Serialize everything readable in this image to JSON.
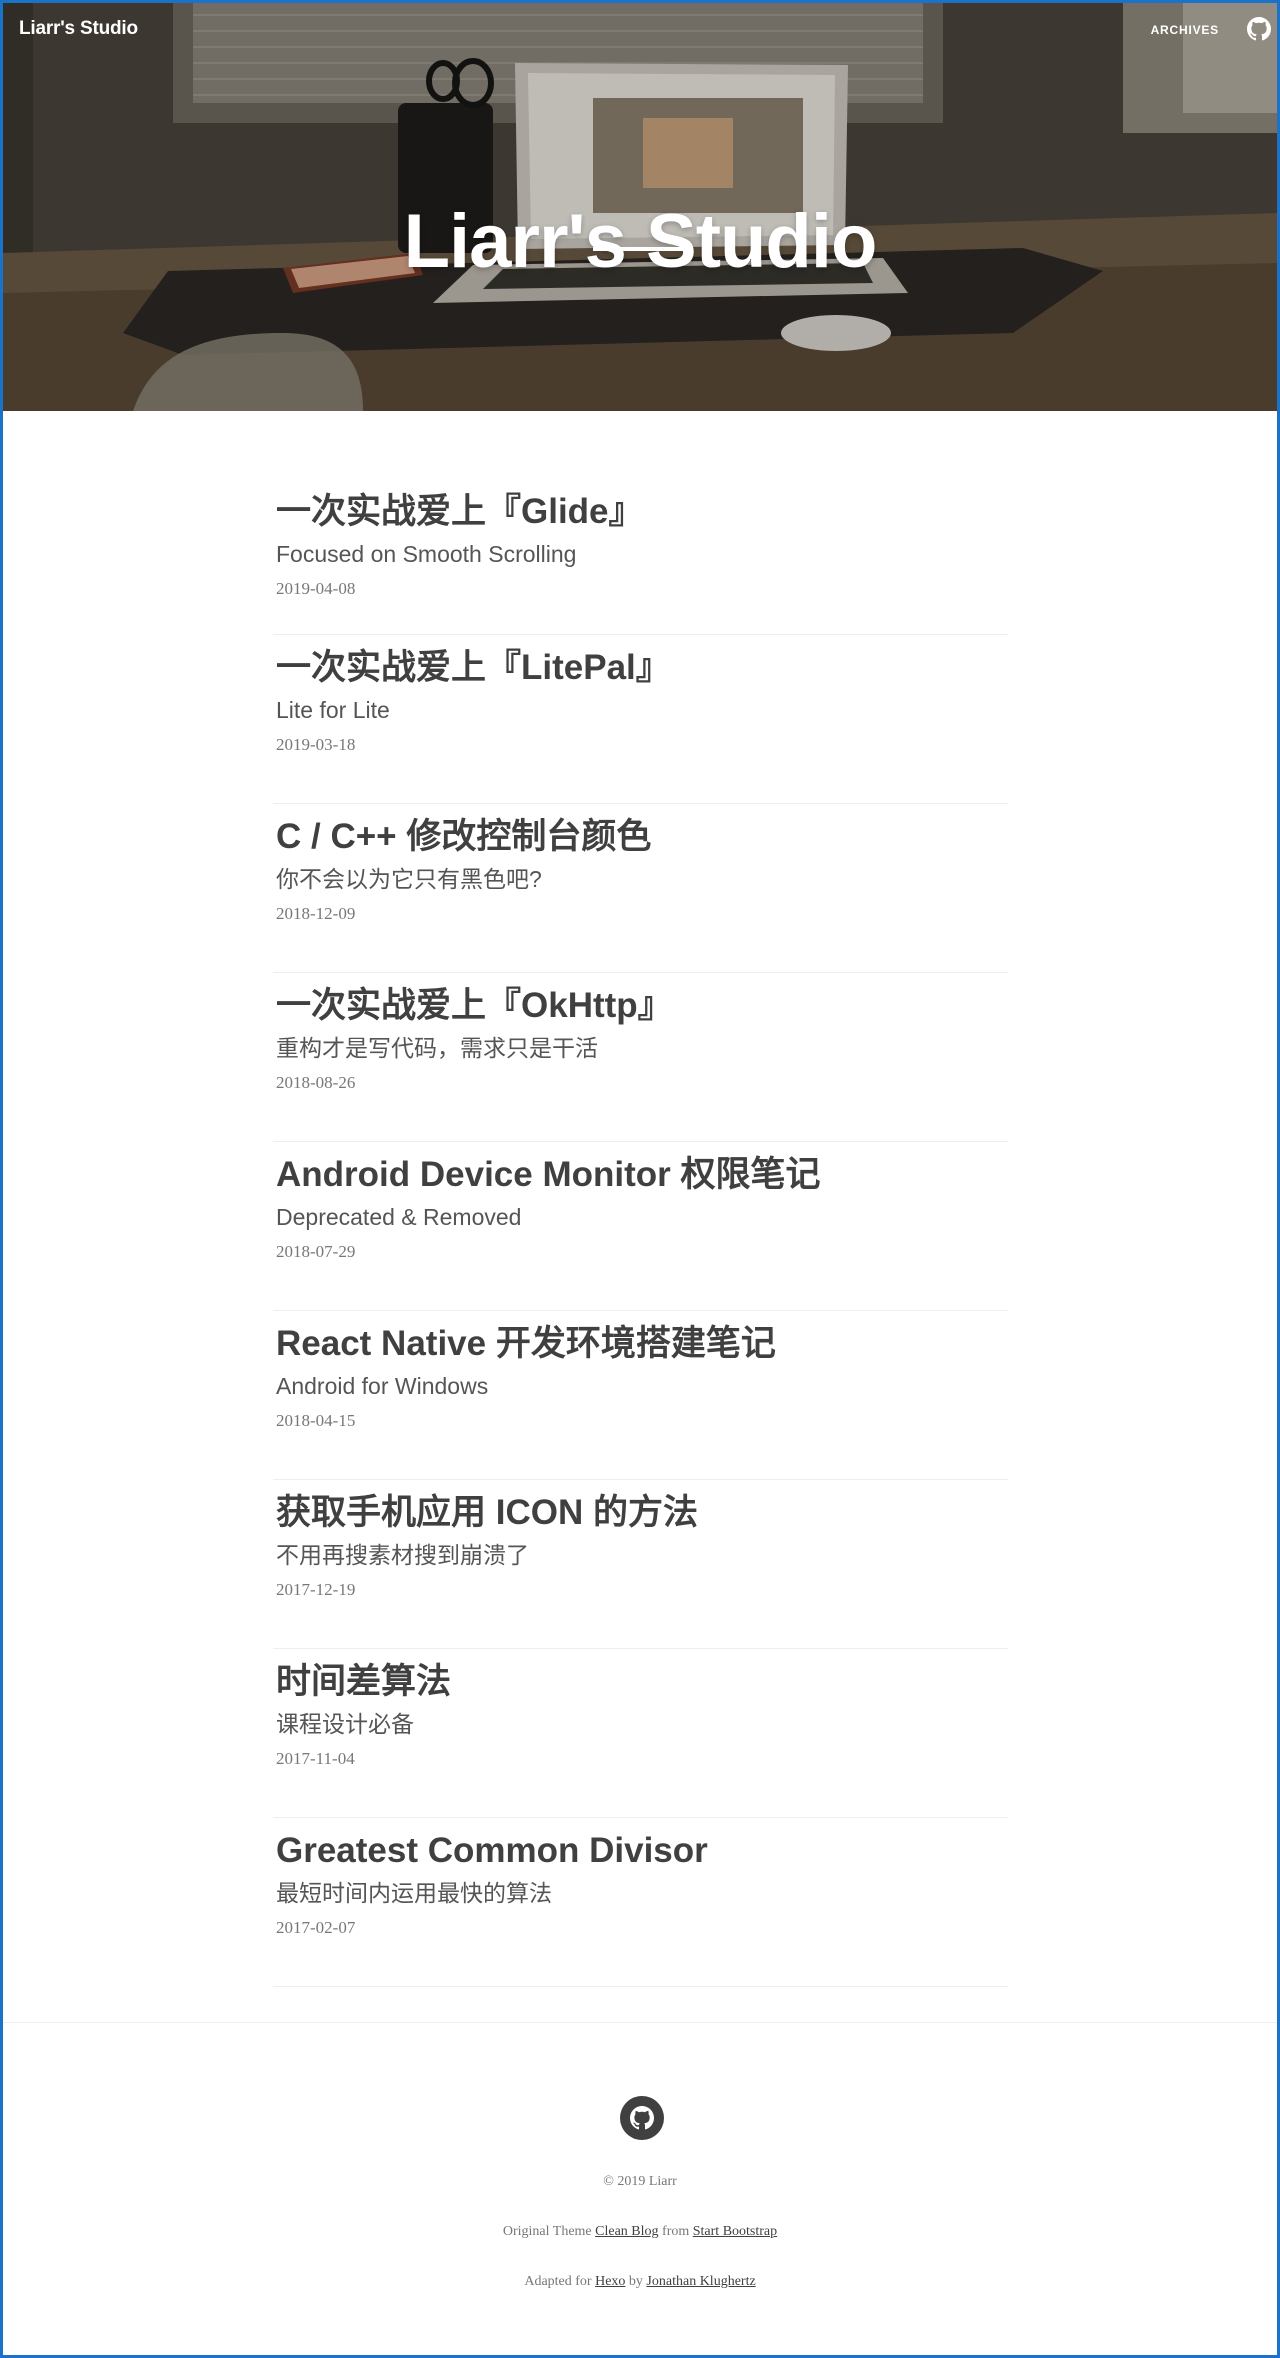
{
  "site": {
    "brand": "Liarr's Studio",
    "hero_title": "Liarr's Studio"
  },
  "nav": {
    "archives_label": "ARCHIVES",
    "github_icon": "github-icon"
  },
  "posts": [
    {
      "title": "一次实战爱上『Glide』",
      "subtitle": "Focused on Smooth Scrolling",
      "date": "2019-04-08"
    },
    {
      "title": "一次实战爱上『LitePal』",
      "subtitle": "Lite for Lite",
      "date": "2019-03-18"
    },
    {
      "title": "C / C++ 修改控制台颜色",
      "subtitle": "你不会以为它只有黑色吧?",
      "date": "2018-12-09"
    },
    {
      "title": "一次实战爱上『OkHttp』",
      "subtitle": "重构才是写代码，需求只是干活",
      "date": "2018-08-26"
    },
    {
      "title": "Android Device Monitor 权限笔记",
      "subtitle": "Deprecated & Removed",
      "date": "2018-07-29"
    },
    {
      "title": "React Native 开发环境搭建笔记",
      "subtitle": "Android for Windows",
      "date": "2018-04-15"
    },
    {
      "title": "获取手机应用 ICON 的方法",
      "subtitle": "不用再搜素材搜到崩溃了",
      "date": "2017-12-19"
    },
    {
      "title": "时间差算法",
      "subtitle": "课程设计必备",
      "date": "2017-11-04"
    },
    {
      "title": "Greatest Common Divisor",
      "subtitle": "最短时间内运用最快的算法",
      "date": "2017-02-07"
    }
  ],
  "footer": {
    "github_icon": "github-icon",
    "copyright": "© 2019 Liarr",
    "theme_prefix": "Original Theme",
    "theme_link": "Clean Blog",
    "theme_from": "from",
    "theme_source": "Start Bootstrap",
    "adapted_prefix": "Adapted for",
    "adapted_link": "Hexo",
    "adapted_by": "by",
    "adapted_author": "Jonathan Klughertz"
  },
  "colors": {
    "frame_border": "#1a73c8",
    "text_dark": "#404040",
    "text_meta": "#777777",
    "divider": "#eeeeee"
  }
}
